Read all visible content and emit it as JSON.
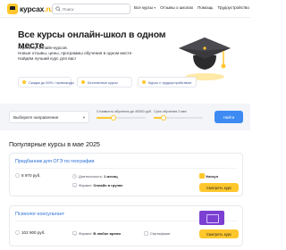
{
  "header": {
    "logo_text": "курсах",
    "logo_suffix": ".ru",
    "search_placeholder": "Поиск",
    "nav": [
      {
        "label": "Все курсы"
      },
      {
        "label": "Отзывы о школах"
      },
      {
        "label": "Помощь"
      },
      {
        "label": "Трудоустройство"
      }
    ]
  },
  "hero": {
    "title": "Все курсы онлайн-школ в одном месте",
    "desc_lines": [
      "Агрегатор онлайн-курсов.",
      "Новые отзывы, цены, программы обучения в одном месте.",
      "Найдём лучший курс для вас!"
    ],
    "chips": [
      {
        "label": "Скидки до 60% / промокоды"
      },
      {
        "label": "Бесплатные курсы"
      },
      {
        "label": "Курсы с трудоустройством"
      }
    ]
  },
  "filter": {
    "select_value": "Выберите направление",
    "price_label": "Стоимость обучения до 40000 руб.",
    "duration_label": "Срок обучения 2 мес",
    "price_fill": 0.35,
    "duration_fill": 0.2,
    "reset_label": "Найти"
  },
  "popular": {
    "title": "Популярные курсы в мае 2025",
    "courses": [
      {
        "title": "Предбанник для ОГЭ по географии",
        "price": "8 970 руб.",
        "duration_label": "Длительность:",
        "duration_value": "1 месяц",
        "format_label": "Формат:",
        "format_value": "Онлайн в группе",
        "school": "Умскул",
        "button": "Смотреть курс"
      },
      {
        "title": "Психолог-консультант",
        "price": "102 900 руб.",
        "duration_label": "",
        "duration_value": "",
        "format_label": "Формат:",
        "format_value": "В любое время",
        "extra": "Сертификат",
        "school": "",
        "button": "Смотреть курс"
      }
    ]
  },
  "colors": {
    "accent": "#ffc72c",
    "link": "#2a6ed6",
    "button_blue": "#3d8bf2",
    "brand_purple": "#7b3fd1"
  },
  "icons": [
    "logo-icon",
    "search-icon",
    "graduation-cap-icon",
    "ruble-icon",
    "clock-icon",
    "monitor-icon",
    "certificate-icon",
    "chevron-down-icon"
  ]
}
